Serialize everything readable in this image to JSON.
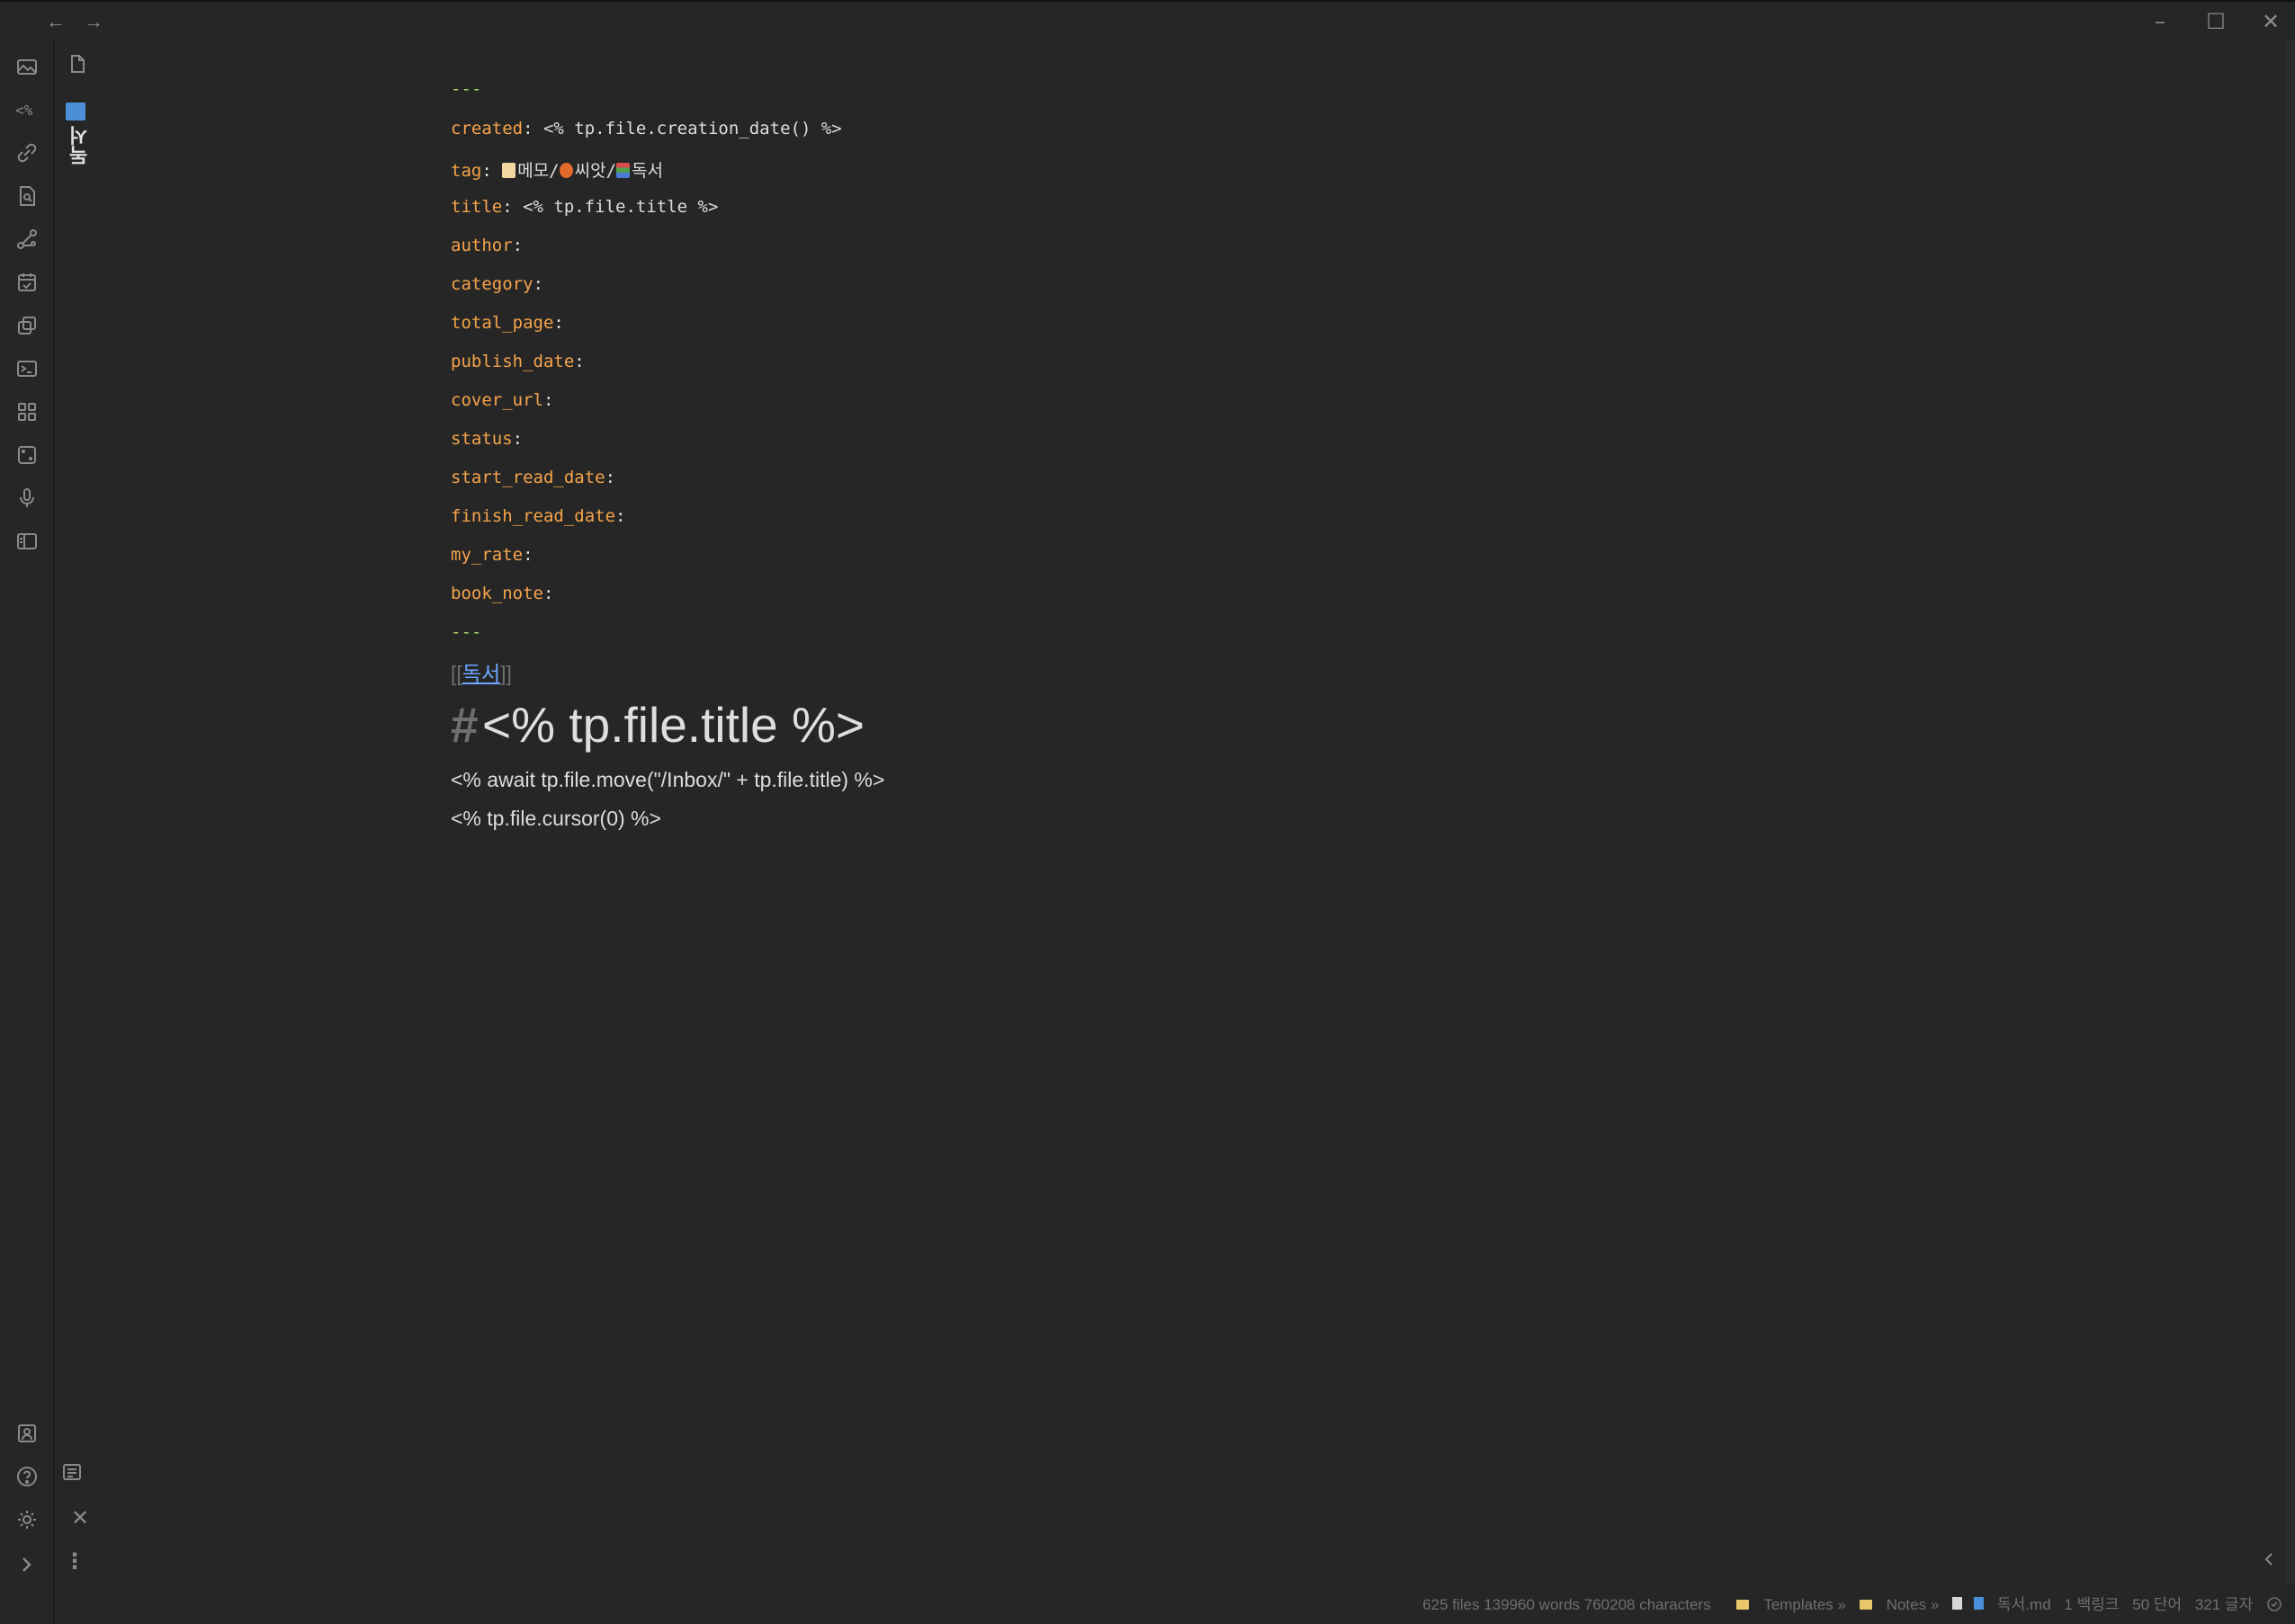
{
  "frontmatter": {
    "delim": "---",
    "fields": [
      {
        "key": "created",
        "value": "<% tp.file.creation_date() %>"
      },
      {
        "key": "tag",
        "value": "메모/ 씨앗/ 독서"
      },
      {
        "key": "title",
        "value": "<% tp.file.title %>"
      },
      {
        "key": "author",
        "value": ""
      },
      {
        "key": "category",
        "value": ""
      },
      {
        "key": "total_page",
        "value": ""
      },
      {
        "key": "publish_date",
        "value": ""
      },
      {
        "key": "cover_url",
        "value": ""
      },
      {
        "key": "status",
        "value": ""
      },
      {
        "key": "start_read_date",
        "value": ""
      },
      {
        "key": "finish_read_date",
        "value": ""
      },
      {
        "key": "my_rate",
        "value": ""
      },
      {
        "key": "book_note",
        "value": ""
      }
    ]
  },
  "tag_parts": [
    "메모/",
    "씨앗/",
    "독서"
  ],
  "wikilink": {
    "open": "[[",
    "label": "독서",
    "close": "]]"
  },
  "heading": {
    "hash": "#",
    "text": "<% tp.file.title %>"
  },
  "body_lines": [
    "<% await tp.file.move(\"/Inbox/\" + tp.file.title) %>",
    "<% tp.file.cursor(0) %>"
  ],
  "tab_label": "독서",
  "status": {
    "stats": "625 files 139960 words 760208 characters",
    "crumb1": "Templates",
    "crumb2": "Notes",
    "crumb3": "독서.md",
    "backlinks": "1 백링크",
    "words": "50 단어",
    "chars": "321 글자"
  },
  "colors": {
    "key": "#f6a44b",
    "dash": "#a8d868",
    "link": "#6ea6ff",
    "bg": "#262626"
  },
  "icons": [
    "image-icon",
    "templater-icon",
    "link-icon",
    "file-search-icon",
    "graph-icon",
    "calendar-icon",
    "copy-icon",
    "terminal-icon",
    "grid-icon",
    "dice-icon",
    "microphone-icon",
    "layout-icon",
    "vault-icon",
    "help-icon",
    "settings-icon",
    "chevron-right-icon"
  ]
}
